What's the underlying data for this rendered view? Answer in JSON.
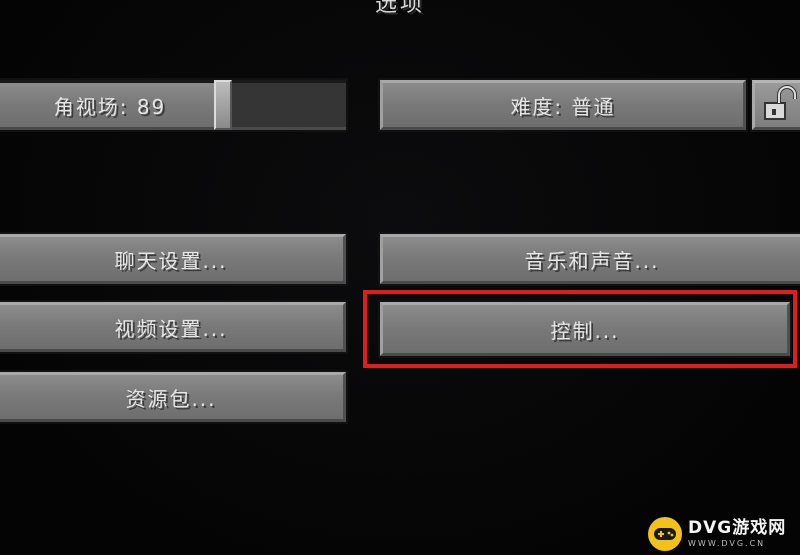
{
  "screen": {
    "title": "选项"
  },
  "options": {
    "fov_label": "角视场: 89",
    "fov_value": 89,
    "difficulty_label": "难度: 普通",
    "chat_settings": "聊天设置...",
    "music_sound": "音乐和声音...",
    "video_settings": "视频设置...",
    "controls": "控制...",
    "resource_packs": "资源包..."
  },
  "difficulty_lock": {
    "icon": "lock-open-icon"
  },
  "annotation": {
    "highlight_color": "#e01d1d"
  },
  "watermark": {
    "brand": "DVG游戏网",
    "url": "WWW.DVG.CN",
    "icon": "gamepad-icon",
    "badge_color": "#f2c21b"
  }
}
